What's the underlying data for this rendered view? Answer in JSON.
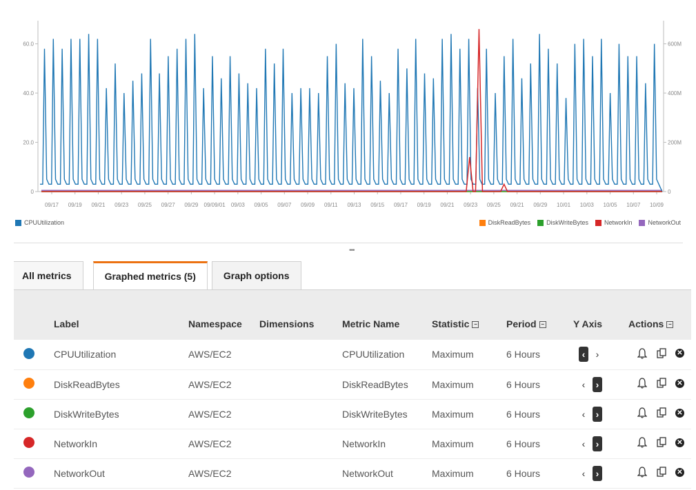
{
  "chart_data": {
    "type": "line",
    "y_left_ticks": [
      "0",
      "20.0",
      "40.0",
      "60.0"
    ],
    "y_left_range": [
      0,
      68
    ],
    "y_right_ticks": [
      "0",
      "200M",
      "400M",
      "600M"
    ],
    "y_right_range": [
      0,
      680
    ],
    "x_tick_labels": [
      "09/17",
      "09/19",
      "09/21",
      "09/23",
      "09/25",
      "09/27",
      "09/29",
      "09/09/01",
      "09/03",
      "09/05",
      "09/07",
      "09/09",
      "09/11",
      "09/13",
      "09/15",
      "09/17",
      "09/19",
      "09/21",
      "09/23",
      "09/25",
      "09/21",
      "09/29",
      "10/01",
      "10/03",
      "10/05",
      "10/07",
      "10/09"
    ],
    "series": [
      {
        "name": "CPUUtilization",
        "color": "#1f77b4",
        "axis": "left",
        "peaks": [
          58,
          62,
          58,
          62,
          62,
          64,
          62,
          42,
          52,
          40,
          45,
          48,
          62,
          48,
          55,
          58,
          62,
          64,
          42,
          55,
          46,
          55,
          48,
          44,
          42,
          58,
          52,
          58,
          40,
          42,
          42,
          40,
          55,
          60,
          44,
          42,
          62,
          55,
          45,
          40,
          58,
          50,
          62,
          48,
          46,
          62,
          64,
          58,
          62,
          42,
          58,
          40,
          55,
          62,
          46,
          52,
          64,
          58,
          52,
          38,
          60,
          62,
          55,
          62,
          40,
          60,
          55,
          55,
          44,
          60
        ],
        "baseline": 3
      },
      {
        "name": "NetworkIn",
        "color": "#d62728",
        "axis": "right",
        "spikes": [
          {
            "pos": 0.69,
            "value": 140
          },
          {
            "pos": 0.705,
            "value": 660
          },
          {
            "pos": 0.745,
            "value": 30
          }
        ]
      },
      {
        "name": "NetworkOut",
        "color": "#9467bd",
        "axis": "right",
        "flat_value": 5
      },
      {
        "name": "DiskReadBytes",
        "color": "#ff7f0e",
        "axis": "right",
        "flat_value": 0
      },
      {
        "name": "DiskWriteBytes",
        "color": "#2ca02c",
        "axis": "right",
        "flat_value": 0
      }
    ],
    "legend_left": [
      {
        "name": "CPUUtilization",
        "color": "#1f77b4"
      }
    ],
    "legend_right": [
      {
        "name": "DiskReadBytes",
        "color": "#ff7f0e"
      },
      {
        "name": "DiskWriteBytes",
        "color": "#2ca02c"
      },
      {
        "name": "NetworkIn",
        "color": "#d62728"
      },
      {
        "name": "NetworkOut",
        "color": "#9467bd"
      }
    ]
  },
  "divider_handle": "•••",
  "tabs": [
    {
      "label": "All metrics",
      "active": false
    },
    {
      "label": "Graphed metrics (5)",
      "active": true
    },
    {
      "label": "Graph options",
      "active": false
    }
  ],
  "table": {
    "headers": {
      "label": "Label",
      "namespace": "Namespace",
      "dimensions": "Dimensions",
      "metric_name": "Metric Name",
      "statistic": "Statistic",
      "period": "Period",
      "y_axis": "Y Axis",
      "actions": "Actions"
    },
    "rows": [
      {
        "color": "#1f77b4",
        "label": "CPUUtilization",
        "namespace": "AWS/EC2",
        "dimensions": "",
        "metric_name": "CPUUtilization",
        "statistic": "Maximum",
        "period": "6 Hours",
        "y_axis": "left"
      },
      {
        "color": "#ff7f0e",
        "label": "DiskReadBytes",
        "namespace": "AWS/EC2",
        "dimensions": "",
        "metric_name": "DiskReadBytes",
        "statistic": "Maximum",
        "period": "6 Hours",
        "y_axis": "right"
      },
      {
        "color": "#2ca02c",
        "label": "DiskWriteBytes",
        "namespace": "AWS/EC2",
        "dimensions": "",
        "metric_name": "DiskWriteBytes",
        "statistic": "Maximum",
        "period": "6 Hours",
        "y_axis": "right"
      },
      {
        "color": "#d62728",
        "label": "NetworkIn",
        "namespace": "AWS/EC2",
        "dimensions": "",
        "metric_name": "NetworkIn",
        "statistic": "Maximum",
        "period": "6 Hours",
        "y_axis": "right"
      },
      {
        "color": "#9467bd",
        "label": "NetworkOut",
        "namespace": "AWS/EC2",
        "dimensions": "",
        "metric_name": "NetworkOut",
        "statistic": "Maximum",
        "period": "6 Hours",
        "y_axis": "right"
      }
    ]
  },
  "icons": {
    "sort": "sort-dropdown-icon",
    "y_left": "chevron-left-icon",
    "y_right": "chevron-right-icon",
    "alarm": "bell-icon",
    "copy": "copy-icon",
    "remove": "remove-icon"
  }
}
